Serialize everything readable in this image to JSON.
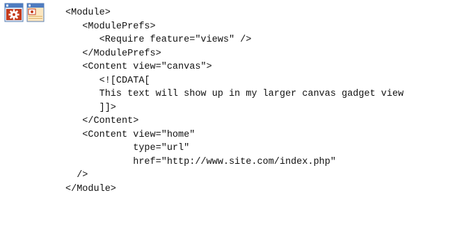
{
  "icons": [
    {
      "name": "gear-window-icon"
    },
    {
      "name": "canvas-window-icon"
    }
  ],
  "code": {
    "lines": [
      "<Module>",
      "   <ModulePrefs>",
      "      <Require feature=\"views\" />",
      "   </ModulePrefs>",
      "   <Content view=\"canvas\">",
      "      <![CDATA[",
      "      This text will show up in my larger canvas gadget view",
      "      ]]>",
      "   </Content>",
      "   <Content view=\"home\"",
      "            type=\"url\"",
      "            href=\"http://www.site.com/index.php\"",
      "  />",
      "</Module>"
    ]
  }
}
